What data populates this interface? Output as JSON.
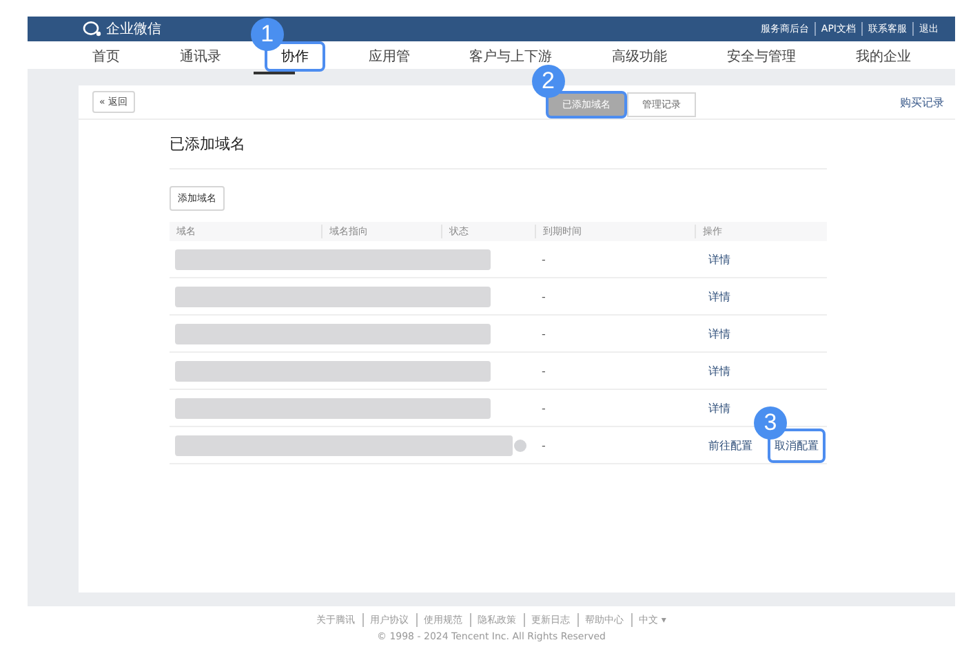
{
  "header": {
    "brand": "企业微信",
    "links": [
      "服务商后台",
      "API文档",
      "联系客服",
      "退出"
    ]
  },
  "nav": [
    {
      "label": "首页",
      "selected": false
    },
    {
      "label": "通讯录",
      "selected": false
    },
    {
      "label": "协作",
      "selected": true,
      "callout": "1"
    },
    {
      "label": "应用管",
      "selected": false
    },
    {
      "label": "客户与上下游",
      "selected": false
    },
    {
      "label": "高级功能",
      "selected": false
    },
    {
      "label": "安全与管理",
      "selected": false
    },
    {
      "label": "我的企业",
      "selected": false
    }
  ],
  "back_button": "« 返回",
  "tabs": [
    {
      "label": "已添加域名",
      "selected": true,
      "callout": "2"
    },
    {
      "label": "管理记录",
      "selected": false
    }
  ],
  "purchase_link": "购买记录",
  "title": "已添加域名",
  "add_button": "添加域名",
  "table": {
    "columns": [
      "域名",
      "域名指向",
      "状态",
      "到期时间",
      "操作"
    ],
    "rows": [
      {
        "expiry": "-",
        "notice": false,
        "actions": [
          {
            "label": "详情"
          }
        ]
      },
      {
        "expiry": "-",
        "notice": false,
        "actions": [
          {
            "label": "详情"
          }
        ]
      },
      {
        "expiry": "-",
        "notice": false,
        "actions": [
          {
            "label": "详情"
          }
        ]
      },
      {
        "expiry": "-",
        "notice": false,
        "actions": [
          {
            "label": "详情"
          }
        ]
      },
      {
        "expiry": "-",
        "notice": false,
        "actions": [
          {
            "label": "详情"
          }
        ]
      },
      {
        "expiry": "-",
        "notice": true,
        "actions": [
          {
            "label": "前往配置"
          },
          {
            "label": "取消配置",
            "callout": "3"
          }
        ]
      }
    ]
  },
  "footer": {
    "links": [
      "关于腾讯",
      "用户协议",
      "使用规范",
      "隐私政策",
      "更新日志",
      "帮助中心",
      "中文 ▾"
    ],
    "copyright": "© 1998 - 2024 Tencent Inc. All Rights Reserved"
  }
}
